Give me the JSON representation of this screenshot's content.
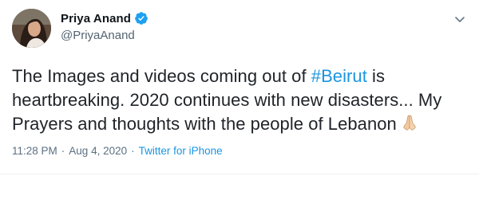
{
  "author": {
    "display_name": "Priya Anand",
    "handle": "@PriyaAnand",
    "verified": true
  },
  "tweet": {
    "line1_before": "The Images and videos coming out of ",
    "hashtag": "#Beirut",
    "line1_after": " is",
    "line2": "heartbreaking. 2020 continues with new disasters... My",
    "line3": "Prayers and thoughts with the people of Lebanon",
    "emoji": "folded-hands"
  },
  "meta": {
    "time": "11:28 PM",
    "date": "Aug 4, 2020",
    "separator": "·",
    "source": "Twitter for iPhone"
  },
  "colors": {
    "link": "#1b95e0",
    "verified": "#1da1f2",
    "meta": "#5b7083"
  }
}
